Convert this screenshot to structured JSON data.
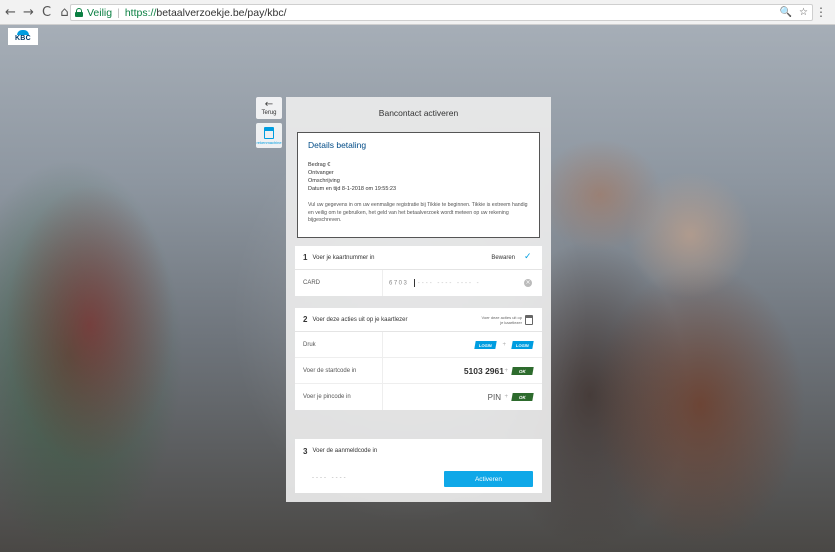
{
  "browser": {
    "nav": {
      "back": "←",
      "forward": "→",
      "reload": "C",
      "home": "⌂"
    },
    "secure_label": "Veilig",
    "url_https": "https://",
    "url_rest": "betaalverzoekje.be/pay/kbc/",
    "icons": {
      "zoom": "🔍",
      "star": "☆",
      "menu": "⋮"
    }
  },
  "brand": {
    "logo_text": "KBC"
  },
  "side": {
    "back_label": "Terug",
    "calc_label": "rekenmachine"
  },
  "modal": {
    "title": "Bancontact activeren",
    "details": {
      "heading": "Details betaling",
      "lines": [
        "Bedrag €",
        "Ontvanger",
        "Omschrijving",
        "Datum en tijd 8-1-2018 om 19:55:23"
      ],
      "note": "Vul uw gegevens in om uw eenmalige registratie bij Tikkie te beginnen. Tikkie is extreem handig en veilig om te gebruiken, het geld van het betaalverzoek wordt meteen op uw rekening bijgeschreven."
    },
    "step1": {
      "num": "1",
      "title": "Voer je kaartnummer in",
      "save_label": "Bewaren",
      "card_label": "CARD",
      "card_prefix": "6703",
      "card_mask": "---- ---- ---- -"
    },
    "step2": {
      "num": "2",
      "title": "Voer deze acties uit op je kaartlezer",
      "reader_note": "Voer deze acties uit op je kaartlezer",
      "row1_label": "Druk",
      "login_label": "LOGIN",
      "row2_label": "Voer de startcode in",
      "start_code": "5103 2961",
      "row3_label": "Voer je pincode in",
      "pin_label": "PIN",
      "ok_label": "OK",
      "plus": "+"
    },
    "step3": {
      "num": "3",
      "title": "Voer de aanmeldcode in",
      "code_mask": "---- ----",
      "activate_label": "Activeren"
    }
  }
}
